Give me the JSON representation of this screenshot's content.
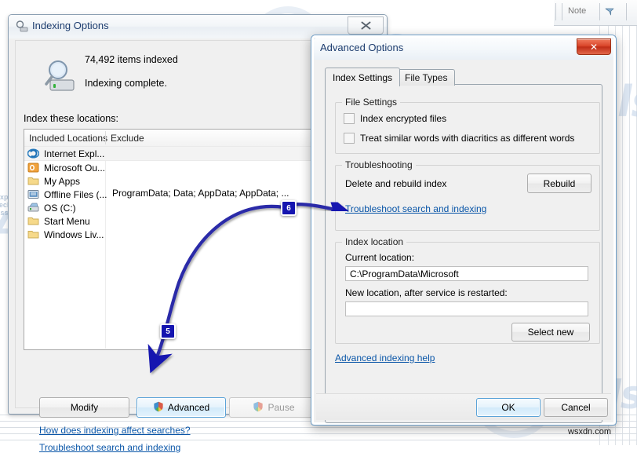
{
  "background": {
    "toolbar": {
      "note_label": "Note",
      "flag_icon": "flag-icon"
    },
    "watermark_bottom_right": "wsxdn.com",
    "watermark_brand": "Appuals",
    "watermark_tagline": "Expert Tech Assistance!"
  },
  "indexing_window": {
    "title": "Indexing Options",
    "title_icon": "indexing-options-icon",
    "close_label": "⌧",
    "status": {
      "icon": "magnifier-drive-icon",
      "items_indexed": "74,492 items indexed",
      "message": "Indexing complete."
    },
    "locations_label": "Index these locations:",
    "columns": {
      "included": "Included Locations",
      "exclude": "Exclude"
    },
    "rows": [
      {
        "icon": "internet-explorer-icon",
        "name": "Internet Expl...",
        "exclude": ""
      },
      {
        "icon": "outlook-icon",
        "name": "Microsoft Ou...",
        "exclude": ""
      },
      {
        "icon": "folder-icon",
        "name": "My Apps",
        "exclude": ""
      },
      {
        "icon": "offline-files-icon",
        "name": "Offline Files (...",
        "exclude": ""
      },
      {
        "icon": "drive-icon",
        "name": "OS (C:)",
        "exclude": "ProgramData; Data; AppData; AppData; ..."
      },
      {
        "icon": "folder-icon",
        "name": "Start Menu",
        "exclude": ""
      },
      {
        "icon": "folder-icon",
        "name": "Windows Liv...",
        "exclude": ""
      }
    ],
    "buttons": {
      "modify": "Modify",
      "advanced": "Advanced",
      "advanced_icon": "uac-shield-icon",
      "pause": "Pause",
      "pause_icon": "uac-shield-icon"
    },
    "links": {
      "how": "How does indexing affect searches?",
      "troubleshoot": "Troubleshoot search and indexing"
    }
  },
  "advanced_dialog": {
    "title": "Advanced Options",
    "close_label": "✕",
    "tabs": [
      {
        "label": "Index Settings",
        "active": true
      },
      {
        "label": "File Types",
        "active": false
      }
    ],
    "file_settings": {
      "caption": "File Settings",
      "index_encrypted": {
        "label": "Index encrypted files",
        "checked": false
      },
      "diacritics": {
        "label": "Treat similar words with diacritics as different words",
        "checked": false
      }
    },
    "troubleshooting": {
      "caption": "Troubleshooting",
      "delete_text": "Delete and rebuild index",
      "rebuild_button": "Rebuild",
      "link": "Troubleshoot search and indexing"
    },
    "index_location": {
      "caption": "Index location",
      "current_label": "Current location:",
      "current_value": "C:\\ProgramData\\Microsoft",
      "new_label": "New location, after service is restarted:",
      "new_value": "",
      "new_placeholder": "",
      "select_button": "Select new"
    },
    "help_link": "Advanced indexing help",
    "footer": {
      "ok": "OK",
      "cancel": "Cancel"
    }
  },
  "annotations": {
    "step5": "5",
    "step6": "6",
    "accent_color": "#1515b0"
  }
}
